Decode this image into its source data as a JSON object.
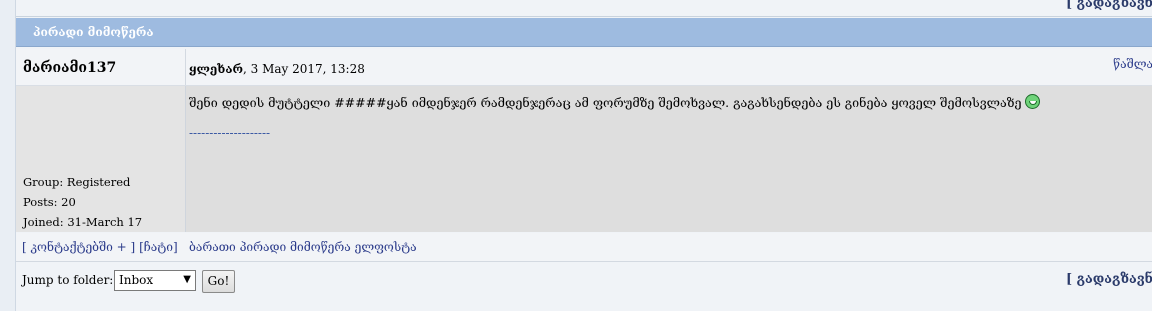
{
  "top": {
    "link": "[ გადაგზავნ"
  },
  "title": "პირადი მიმოწერა",
  "post": {
    "author": "მარიამი137",
    "subject_label": "ყლეხარ",
    "date": ", 3 May 2017, 13:28",
    "delete_link": "წაშლა",
    "profile": {
      "group": "Group: Registered",
      "posts": "Posts: 20",
      "joined": "Joined: 31-March 17"
    },
    "message": "შენი დედის მუტტელი #####ყან იმდენჯერ რამდენჯერაც ამ ფორუმზე შემოხვალ. გაგახსენდება ეს გინება ყოველ შემოსვლაზე",
    "smiley_icon": "smiley-icon",
    "signature": "--------------------"
  },
  "actions": {
    "contacts": "[ კონტაქტებში + ]",
    "block": "[ჩატი]",
    "history": "ბარათი პირადი მიმოწერა ელფოსტა"
  },
  "folder": {
    "label": "Jump to folder:",
    "selected": "Inbox",
    "go": "Go!",
    "forward_link": "[ გადაგზავნ"
  }
}
